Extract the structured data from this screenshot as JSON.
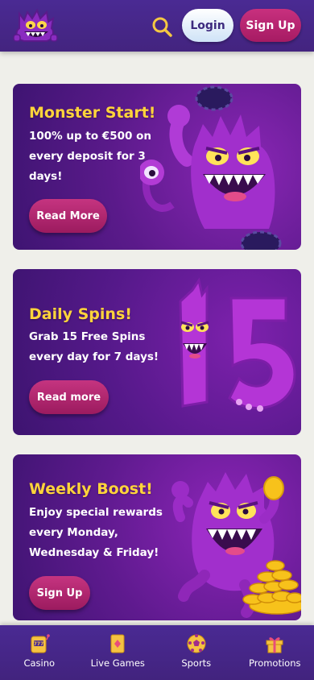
{
  "header": {
    "login_label": "Login",
    "signup_label": "Sign Up"
  },
  "promos": [
    {
      "title": "Monster Start!",
      "description": "100% up to €500 on\nevery deposit for 3\ndays!",
      "button_label": "Read More"
    },
    {
      "title": "Daily Spins!",
      "description": "Grab 15 Free Spins\nevery day for 7 days!",
      "button_label": "Read more",
      "art_number": "15"
    },
    {
      "title": "Weekly Boost!",
      "description": "Enjoy special rewards\nevery Monday,\nWednesday & Friday!",
      "button_label": "Sign Up"
    }
  ],
  "bottom_nav": {
    "items": [
      {
        "label": "Casino",
        "icon": "slot-machine-icon"
      },
      {
        "label": "Live Games",
        "icon": "playing-card-icon"
      },
      {
        "label": "Sports",
        "icon": "soccer-ball-icon"
      },
      {
        "label": "Promotions",
        "icon": "gift-icon"
      }
    ]
  },
  "colors": {
    "header_bg": "#4a2a93",
    "accent_pink": "#b8246f",
    "title_yellow": "#ffd43b",
    "page_bg": "#efefea"
  }
}
